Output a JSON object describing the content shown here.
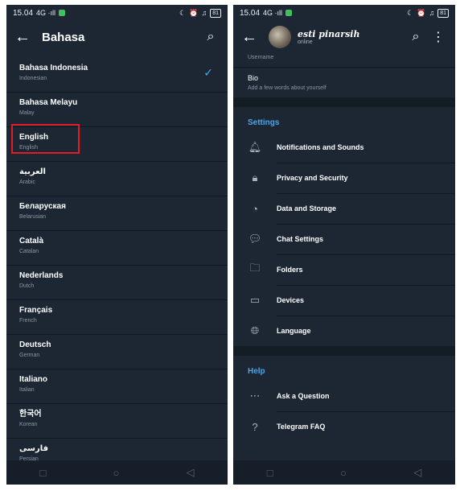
{
  "status": {
    "time": "15.04",
    "left_meta": "4G ·ıll",
    "battery": "81"
  },
  "left": {
    "title": "Bahasa",
    "languages": [
      {
        "name": "Bahasa Indonesia",
        "sub": "Indonesian",
        "selected": true
      },
      {
        "name": "Bahasa Melayu",
        "sub": "Malay"
      },
      {
        "name": "English",
        "sub": "English"
      },
      {
        "name": "العربية",
        "sub": "Arabic"
      },
      {
        "name": "Беларуская",
        "sub": "Belarusian"
      },
      {
        "name": "Català",
        "sub": "Catalan"
      },
      {
        "name": "Nederlands",
        "sub": "Dutch"
      },
      {
        "name": "Français",
        "sub": "French"
      },
      {
        "name": "Deutsch",
        "sub": "German"
      },
      {
        "name": "Italiano",
        "sub": "Italian"
      },
      {
        "name": "한국어",
        "sub": "Korean"
      },
      {
        "name": "فارسی",
        "sub": "Persian"
      }
    ]
  },
  "right": {
    "profile": {
      "name": "esti pinarsih",
      "status": "online"
    },
    "username_label": "Username",
    "bio": {
      "title": "Bio",
      "hint": "Add a few words about yourself"
    },
    "settings_header": "Settings",
    "settings": [
      {
        "label": "Notifications and Sounds",
        "icon": "bell-icon"
      },
      {
        "label": "Privacy and Security",
        "icon": "lock-icon"
      },
      {
        "label": "Data and Storage",
        "icon": "pie-icon"
      },
      {
        "label": "Chat Settings",
        "icon": "chat-bubble-icon"
      },
      {
        "label": "Folders",
        "icon": "folder-icon"
      },
      {
        "label": "Devices",
        "icon": "laptop-icon"
      },
      {
        "label": "Language",
        "icon": "globe-icon"
      }
    ],
    "help_header": "Help",
    "help": [
      {
        "label": "Ask a Question",
        "icon": "chat-dots-icon"
      },
      {
        "label": "Telegram FAQ",
        "icon": "question-icon"
      }
    ]
  },
  "colors": {
    "background": "#1d2733",
    "accent": "#4ba6e8",
    "highlight": "#e11c2a"
  }
}
